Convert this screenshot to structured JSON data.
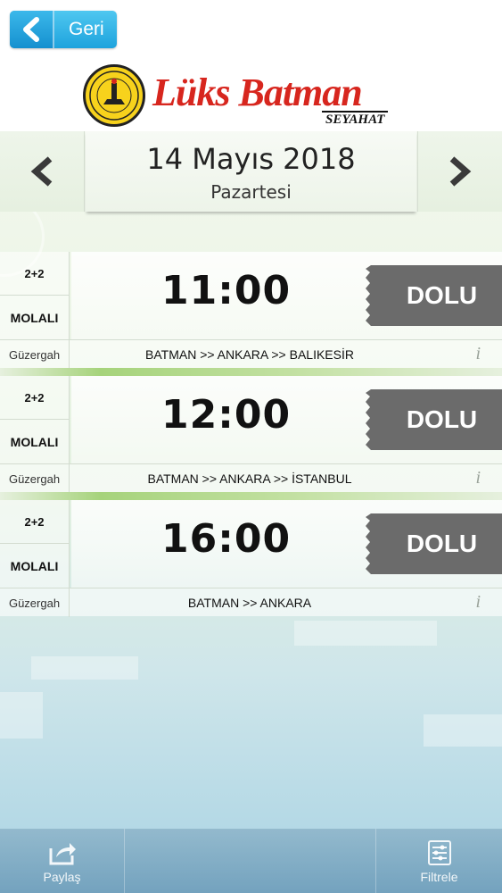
{
  "header": {
    "back_label": "Geri",
    "brand_name": "Lüks Batman",
    "brand_sub": "SEYAHAT",
    "seal_text": "LÜKS BATMAN SEYAHAT"
  },
  "date_nav": {
    "date": "14 Mayıs 2018",
    "day": "Pazartesi"
  },
  "trips": [
    {
      "seat_type": "2+2",
      "stop_type": "MOLALI",
      "time": "11:00",
      "status": "DOLU",
      "route_label": "Güzergah",
      "route": "BATMAN >> ANKARA >> BALIKESİR",
      "info": "i"
    },
    {
      "seat_type": "2+2",
      "stop_type": "MOLALI",
      "time": "12:00",
      "status": "DOLU",
      "route_label": "Güzergah",
      "route": "BATMAN >> ANKARA >> İSTANBUL",
      "info": "i"
    },
    {
      "seat_type": "2+2",
      "stop_type": "MOLALI",
      "time": "16:00",
      "status": "DOLU",
      "route_label": "Güzergah",
      "route": "BATMAN >> ANKARA",
      "info": "i"
    }
  ],
  "bottom_bar": {
    "share_label": "Paylaş",
    "filter_label": "Filtrele"
  },
  "colors": {
    "back_button": "#1ea3dd",
    "brand_red": "#d7261e",
    "ticket_grey": "#6b6b6b",
    "separator_green": "#a6d37b"
  }
}
